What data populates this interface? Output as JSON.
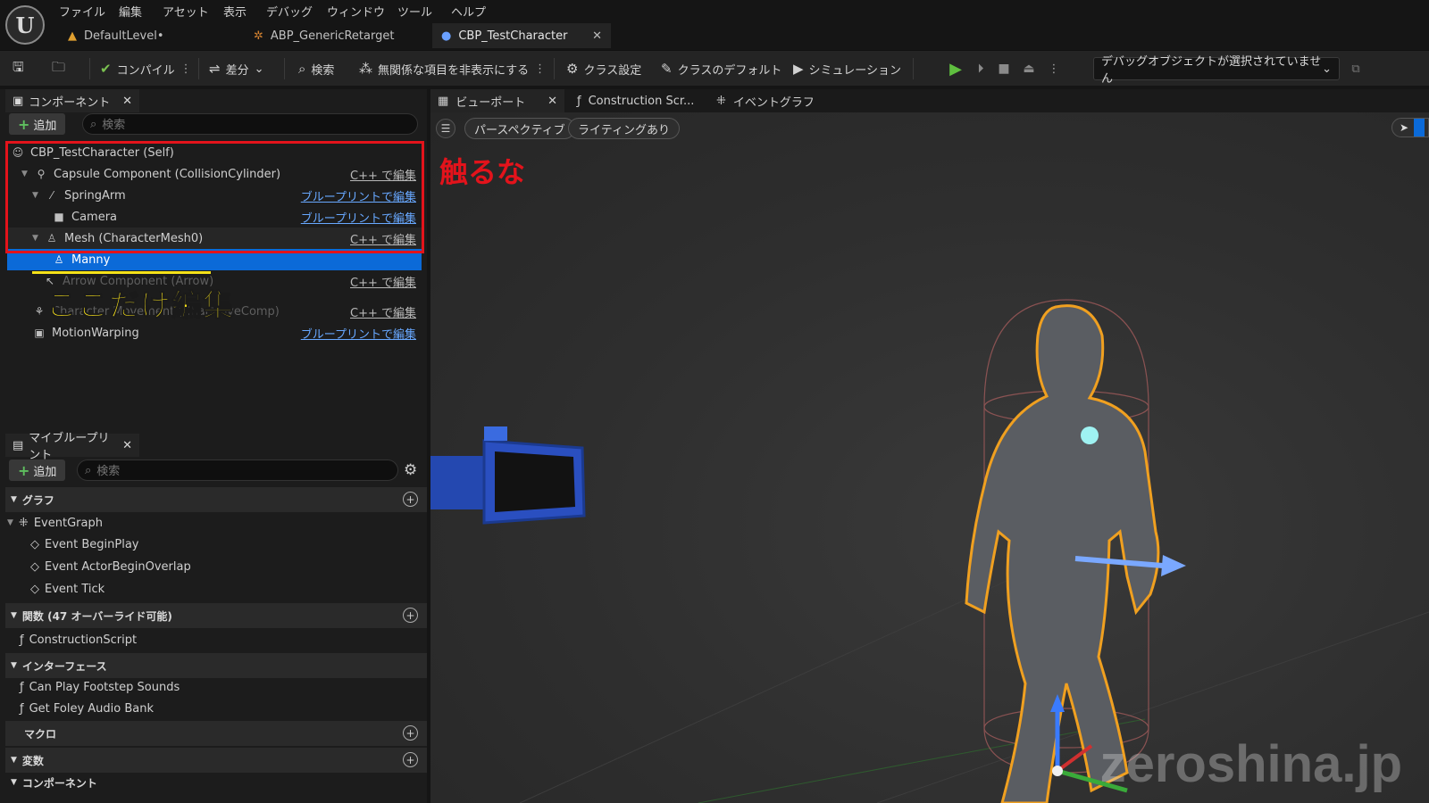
{
  "menu": [
    "ファイル",
    "編集",
    "アセット",
    "表示",
    "デバッグ",
    "ウィンドウ",
    "ツール",
    "ヘルプ"
  ],
  "tabs": [
    {
      "label": "DefaultLevel•"
    },
    {
      "label": "ABP_GenericRetarget"
    },
    {
      "label": "CBP_TestCharacter"
    }
  ],
  "toolbar": {
    "compile": "コンパイル",
    "diff": "差分",
    "search": "検索",
    "hide_unrelated": "無関係な項目を非表示にする",
    "class_settings": "クラス設定",
    "class_defaults": "クラスのデフォルト",
    "simulation": "シミュレーション",
    "debug_object": "デバッグオブジェクトが選択されていません"
  },
  "components_panel": {
    "tab": "コンポーネント",
    "add": "追加",
    "search_placeholder": "検索",
    "rows": [
      {
        "label": "CBP_TestCharacter (Self)",
        "edit": ""
      },
      {
        "label": "Capsule Component (CollisionCylinder)",
        "edit": "C++ で編集"
      },
      {
        "label": "SpringArm",
        "edit": "ブループリントで編集"
      },
      {
        "label": "Camera",
        "edit": "ブループリントで編集"
      },
      {
        "label": "Mesh (CharacterMesh0)",
        "edit": "C++ で編集"
      },
      {
        "label": "Manny",
        "edit": ""
      },
      {
        "label": "Arrow Component (Arrow)",
        "edit": "C++ で編集"
      },
      {
        "label": "Character Movement (CharMoveComp)",
        "edit": "C++ で編集"
      },
      {
        "label": "MotionWarping",
        "edit": "ブループリントで編集"
      }
    ]
  },
  "annotations": {
    "dont_touch": "触るな",
    "edit_only_here": "ここだけ編集"
  },
  "my_blueprint": {
    "tab": "マイブループリント",
    "add": "追加",
    "search_placeholder": "検索",
    "graph_section": "グラフ",
    "event_graph": "EventGraph",
    "events": [
      "Event BeginPlay",
      "Event ActorBeginOverlap",
      "Event Tick"
    ],
    "functions_section": "関数 (47 オーバーライド可能)",
    "construction_script": "ConstructionScript",
    "interface_section": "インターフェース",
    "interfaces": [
      "Can Play Footstep Sounds",
      "Get Foley Audio Bank"
    ],
    "macro_section": "マクロ",
    "variables_section": "変数",
    "components_section": "コンポーネント"
  },
  "viewport": {
    "tabs": [
      "ビューポート",
      "Construction Scr...",
      "イベントグラフ"
    ],
    "perspective": "パースペクティブ",
    "lighting": "ライティングあり",
    "watermark": "zeroshina.jp"
  },
  "colors": {
    "accent_blue": "#0b6ad8",
    "annotation_red": "#e3131b",
    "annotation_yellow": "#ffe81a",
    "link_blue": "#68a8ff",
    "play_green": "#5fbf3f"
  }
}
